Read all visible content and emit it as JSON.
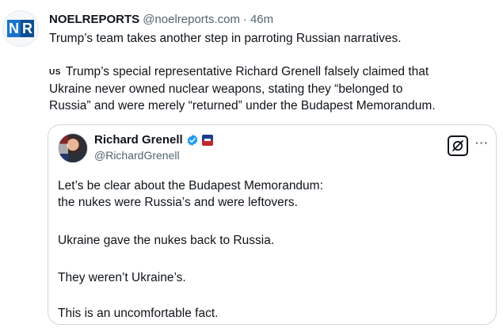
{
  "post": {
    "author_name": "NOELREPORTS",
    "handle": "@noelreports.com",
    "separator": "·",
    "time": "46m",
    "logo_text": "NR",
    "headline": "Trump’s team takes another step in parroting Russian narratives.",
    "flag_label": "US",
    "body_lines": [
      "Trump’s special representative Richard Grenell falsely claimed that",
      "Ukraine never owned nuclear weapons, stating they “belonged to",
      "Russia” and were merely “returned” under the Budapest Memorandum."
    ]
  },
  "quote": {
    "name": "Richard Grenell",
    "handle": "@RichardGrenell",
    "verified_icon": "verified-badge-icon",
    "affiliation_icon": "affiliation-badge-icon",
    "action_icon": "grok-icon",
    "more_icon": "more-icon",
    "more_label": "···",
    "lines": [
      "Let’s be clear about the Budapest Memorandum:",
      "the nukes were Russia’s and were leftovers.",
      "Ukraine gave the nukes back to Russia.",
      "They weren’t Ukraine’s.",
      "This is an uncomfortable fact."
    ]
  },
  "colors": {
    "text": "#0f1419",
    "secondary": "#536471",
    "border": "#cfd9de",
    "verified": "#1d9bf0"
  }
}
